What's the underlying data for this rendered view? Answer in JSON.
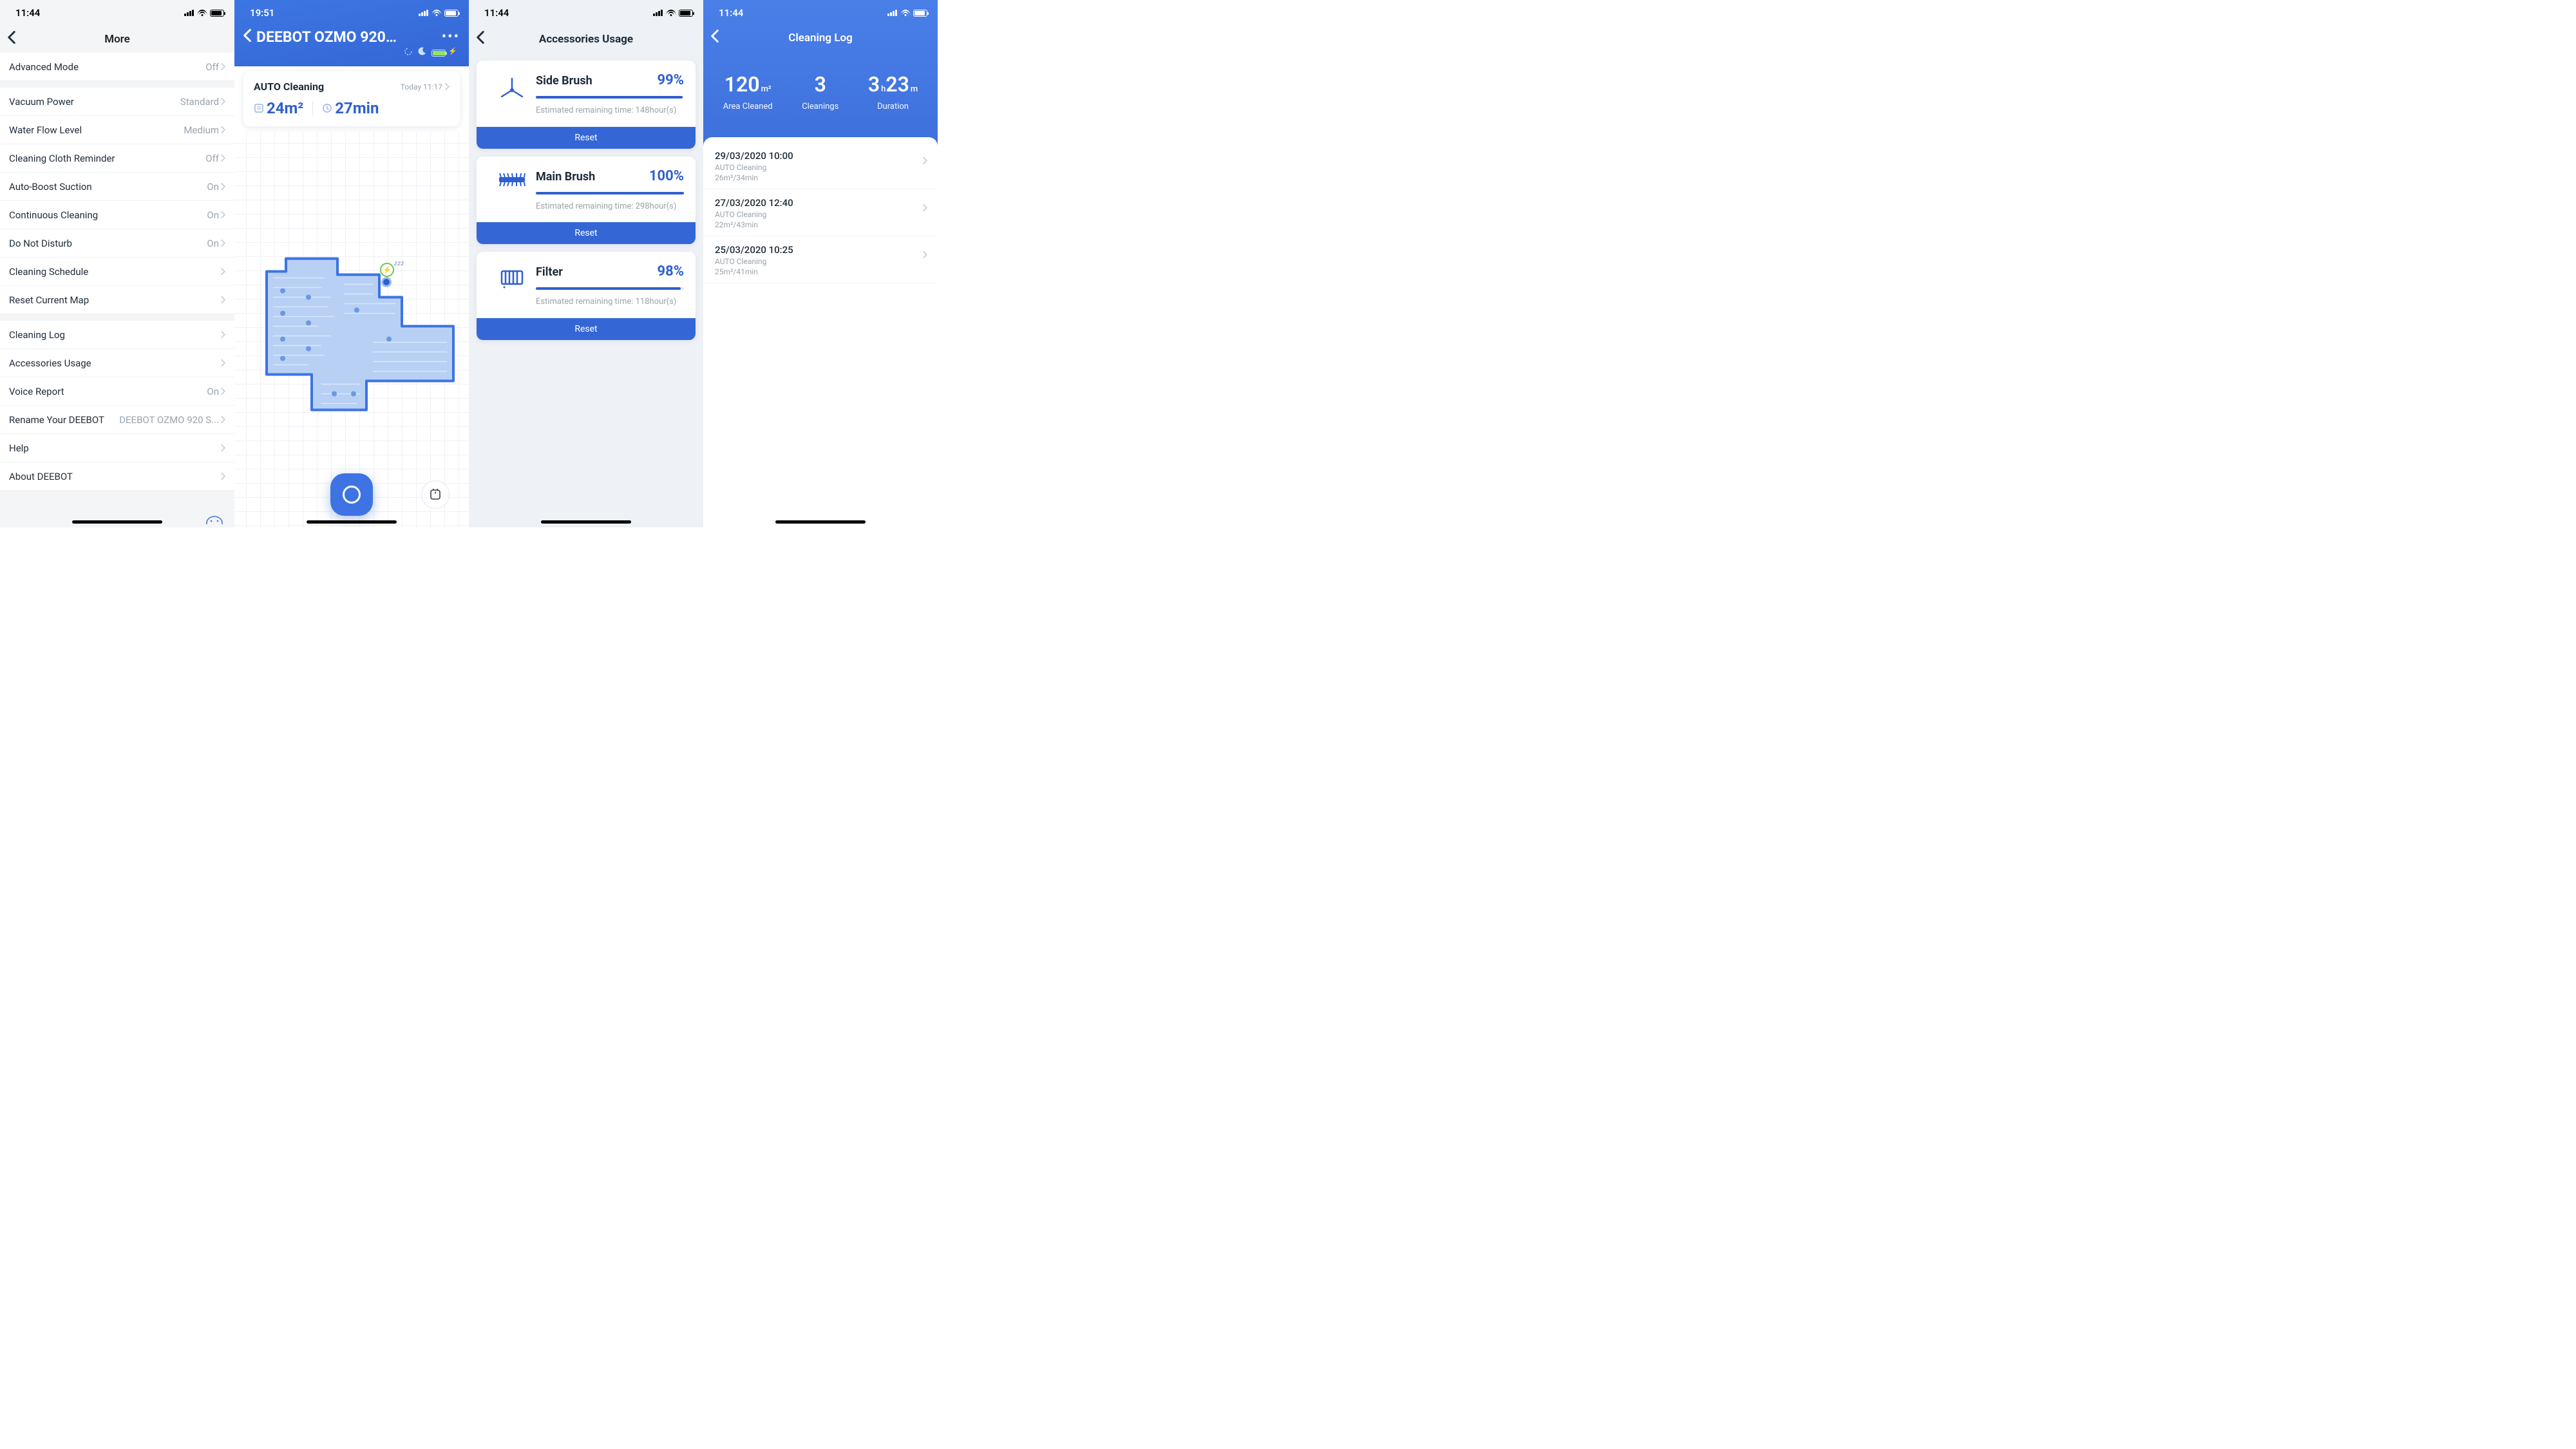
{
  "screen1": {
    "status_time": "11:44",
    "title": "More",
    "rows": [
      {
        "label": "Advanced Mode",
        "value": "Off",
        "chev": true,
        "gapAfter": true
      },
      {
        "label": "Vacuum Power",
        "value": "Standard",
        "chev": true
      },
      {
        "label": "Water Flow Level",
        "value": "Medium",
        "chev": true
      },
      {
        "label": "Cleaning Cloth Reminder",
        "value": "Off",
        "chev": true
      },
      {
        "label": "Auto-Boost Suction",
        "value": "On",
        "chev": true
      },
      {
        "label": "Continuous Cleaning",
        "value": "On",
        "chev": true
      },
      {
        "label": "Do Not Disturb",
        "value": "On",
        "chev": true
      },
      {
        "label": "Cleaning Schedule",
        "value": "",
        "chev": true
      },
      {
        "label": "Reset Current Map",
        "value": "",
        "chev": true,
        "gapAfter": true
      },
      {
        "label": "Cleaning Log",
        "value": "",
        "chev": true
      },
      {
        "label": "Accessories Usage",
        "value": "",
        "chev": true
      },
      {
        "label": "Voice Report",
        "value": "On",
        "chev": true
      },
      {
        "label": "Rename Your DEEBOT",
        "value": "DEEBOT OZMO 920 S...",
        "chev": true
      },
      {
        "label": "Help",
        "value": "",
        "chev": true
      },
      {
        "label": "About DEEBOT",
        "value": "",
        "chev": true
      }
    ]
  },
  "screen2": {
    "status_time": "19:51",
    "title": "DEEBOT OZMO 920…",
    "card_label": "AUTO Cleaning",
    "card_time": "Today 11:17",
    "area_value": "24m²",
    "duration_value": "27min",
    "battery_pct": 95
  },
  "screen3": {
    "status_time": "11:44",
    "title": "Accessories Usage",
    "items": [
      {
        "name": "Side Brush",
        "pct": "99%",
        "pctnum": 99,
        "est": "Estimated remaining time: 148hour(s)",
        "reset": "Reset",
        "icon": "side-brush"
      },
      {
        "name": "Main Brush",
        "pct": "100%",
        "pctnum": 100,
        "est": "Estimated remaining time: 298hour(s)",
        "reset": "Reset",
        "icon": "main-brush"
      },
      {
        "name": "Filter",
        "pct": "98%",
        "pctnum": 98,
        "est": "Estimated remaining time: 118hour(s)",
        "reset": "Reset",
        "icon": "filter"
      }
    ]
  },
  "screen4": {
    "status_time": "11:44",
    "title": "Cleaning Log",
    "summary": {
      "area_num": "120",
      "area_unit": "m²",
      "area_label": "Area Cleaned",
      "count_num": "3",
      "count_label": "Cleanings",
      "dur_h": "3",
      "dur_hu": "h",
      "dur_m": "23",
      "dur_mu": "m",
      "dur_label": "Duration"
    },
    "logs": [
      {
        "dt": "29/03/2020 10:00",
        "mode": "AUTO Cleaning",
        "stat": "26m²/34min"
      },
      {
        "dt": "27/03/2020 12:40",
        "mode": "AUTO Cleaning",
        "stat": "22m²/43min"
      },
      {
        "dt": "25/03/2020 10:25",
        "mode": "AUTO Cleaning",
        "stat": "25m²/41min"
      }
    ]
  }
}
